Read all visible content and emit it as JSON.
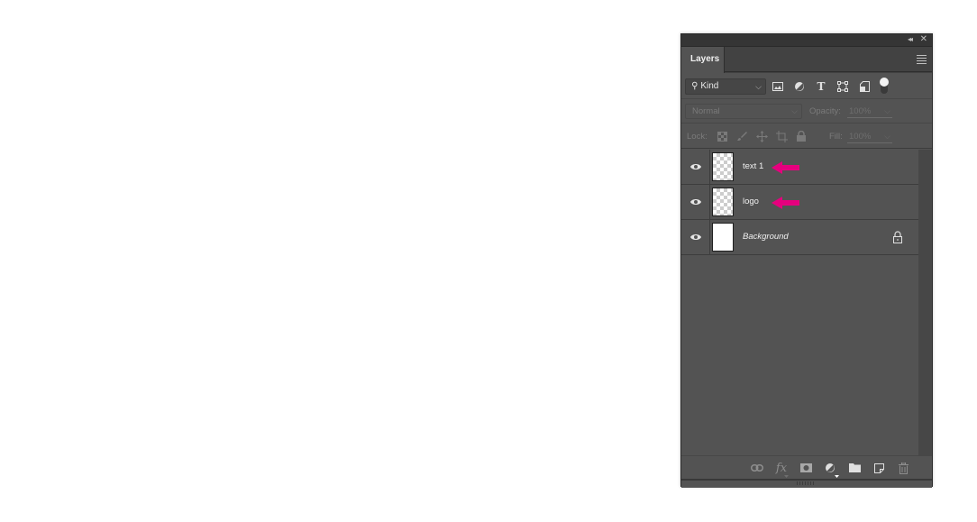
{
  "panel": {
    "title_bar": {
      "collapse_icon": "double-chevron-left-icon",
      "close_icon": "close-icon",
      "collapse_glyph": "◂◂",
      "close_glyph": "✕"
    },
    "tab": {
      "label": "Layers"
    },
    "menu_icon": "hamburger-menu-icon"
  },
  "filter": {
    "kind_label": "Kind",
    "search_glyph": "⚲",
    "chevron_glyph": "⌵",
    "icons": [
      "pixel-layer-filter-icon",
      "adjustment-layer-filter-icon",
      "type-layer-filter-icon",
      "shape-layer-filter-icon",
      "smart-object-filter-icon"
    ],
    "type_glyph": "T",
    "toggle": "filter-toggle"
  },
  "blend": {
    "mode": "Normal",
    "opacity_label": "Opacity:",
    "opacity_value": "100%",
    "chevron_glyph": "⌵"
  },
  "lock": {
    "label": "Lock:",
    "icons": [
      "lock-transparent-pixels-icon",
      "lock-image-pixels-icon",
      "lock-position-icon",
      "lock-artboard-icon",
      "lock-all-icon"
    ],
    "fill_label": "Fill:",
    "fill_value": "100%"
  },
  "layers": [
    {
      "name": "text 1",
      "visible": true,
      "thumbnail": "transparent",
      "annotation_arrow": true,
      "locked": false,
      "italic": false
    },
    {
      "name": "logo",
      "visible": true,
      "thumbnail": "transparent",
      "annotation_arrow": true,
      "locked": false,
      "italic": false
    },
    {
      "name": "Background",
      "visible": true,
      "thumbnail": "white",
      "annotation_arrow": false,
      "locked": true,
      "italic": true
    }
  ],
  "annotation_color": "#e6007e",
  "footer": {
    "buttons": [
      "link-layers-icon",
      "layer-style-fx-icon",
      "add-mask-icon",
      "new-adjustment-layer-icon",
      "new-group-icon",
      "new-layer-icon",
      "delete-layer-icon"
    ],
    "fx_label": "fx"
  }
}
